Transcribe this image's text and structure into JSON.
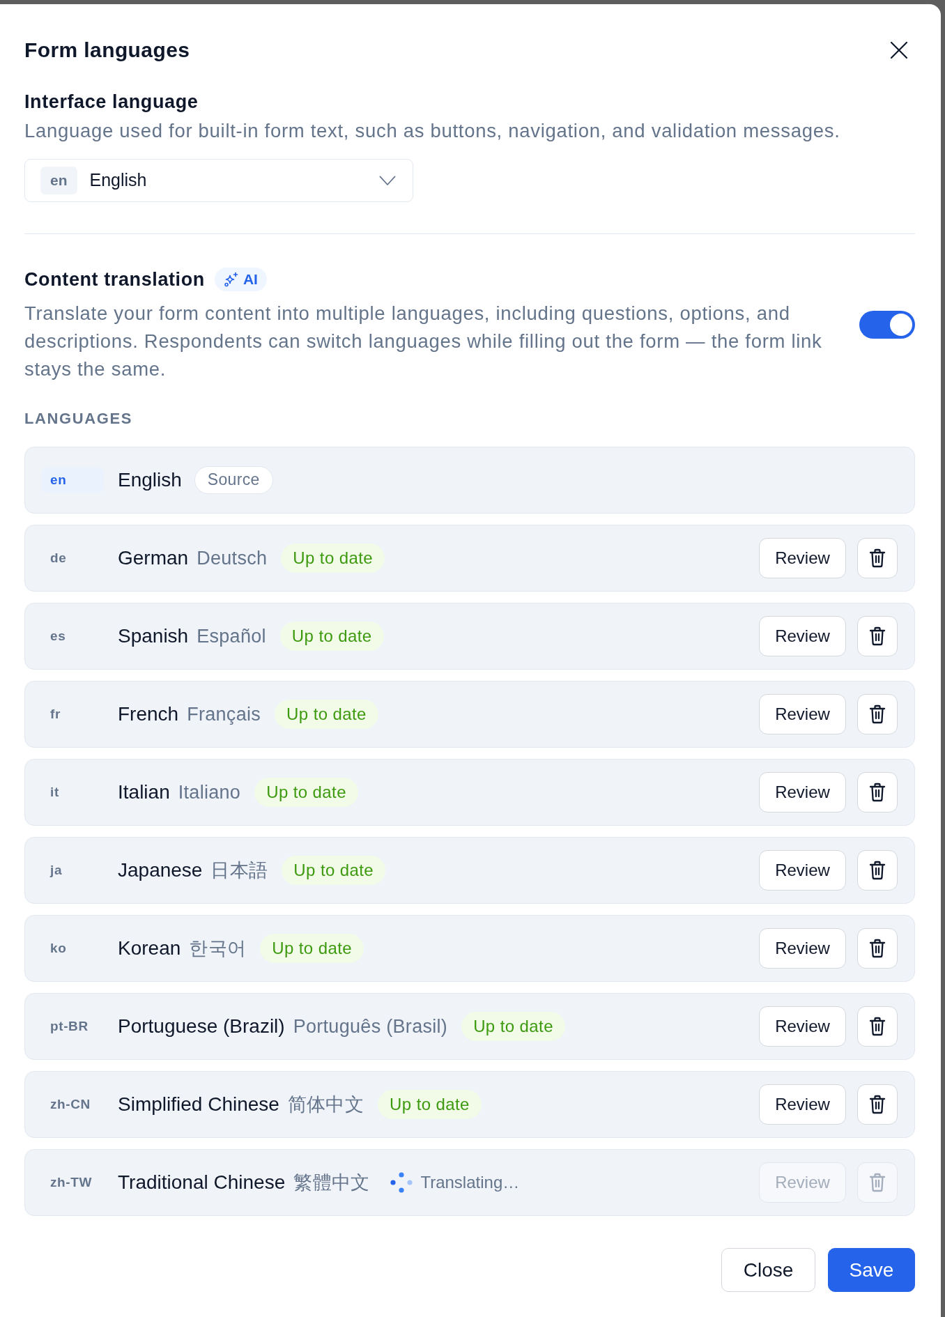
{
  "dialog": {
    "title": "Form languages"
  },
  "interface_language": {
    "title": "Interface language",
    "description": "Language used for built-in form text, such as buttons, navigation, and validation messages.",
    "select": {
      "code": "en",
      "value": "English"
    }
  },
  "content_translation": {
    "title": "Content translation",
    "badge": "AI",
    "description": "Translate your form content into multiple languages, including questions, options, and descriptions. Respondents can switch languages while filling out the form — the form link stays the same.",
    "on": true
  },
  "languages": {
    "heading": "LANGUAGES",
    "items": [
      {
        "code": "en",
        "name": "English",
        "status": {
          "kind": "source",
          "label": "Source"
        }
      },
      {
        "code": "de",
        "name": "German",
        "native": "Deutsch",
        "status": {
          "kind": "up_to_date",
          "label": "Up to date"
        },
        "actions": {
          "review": "Review",
          "disabled": false
        }
      },
      {
        "code": "es",
        "name": "Spanish",
        "native": "Español",
        "status": {
          "kind": "up_to_date",
          "label": "Up to date"
        },
        "actions": {
          "review": "Review",
          "disabled": false
        }
      },
      {
        "code": "fr",
        "name": "French",
        "native": "Français",
        "status": {
          "kind": "up_to_date",
          "label": "Up to date"
        },
        "actions": {
          "review": "Review",
          "disabled": false
        }
      },
      {
        "code": "it",
        "name": "Italian",
        "native": "Italiano",
        "status": {
          "kind": "up_to_date",
          "label": "Up to date"
        },
        "actions": {
          "review": "Review",
          "disabled": false
        }
      },
      {
        "code": "ja",
        "name": "Japanese",
        "native": "日本語",
        "status": {
          "kind": "up_to_date",
          "label": "Up to date"
        },
        "actions": {
          "review": "Review",
          "disabled": false
        }
      },
      {
        "code": "ko",
        "name": "Korean",
        "native": "한국어",
        "status": {
          "kind": "up_to_date",
          "label": "Up to date"
        },
        "actions": {
          "review": "Review",
          "disabled": false
        }
      },
      {
        "code": "pt-BR",
        "name": "Portuguese (Brazil)",
        "native": "Português (Brasil)",
        "status": {
          "kind": "up_to_date",
          "label": "Up to date"
        },
        "actions": {
          "review": "Review",
          "disabled": false
        }
      },
      {
        "code": "zh-CN",
        "name": "Simplified Chinese",
        "native": "简体中文",
        "status": {
          "kind": "up_to_date",
          "label": "Up to date"
        },
        "actions": {
          "review": "Review",
          "disabled": false
        }
      },
      {
        "code": "zh-TW",
        "name": "Traditional Chinese",
        "native": "繁體中文",
        "status": {
          "kind": "translating",
          "label": "Translating…"
        },
        "actions": {
          "review": "Review",
          "disabled": true
        }
      }
    ]
  },
  "footer": {
    "buttons": [
      {
        "label": "Close",
        "kind": "secondary"
      },
      {
        "label": "Save",
        "kind": "primary"
      }
    ]
  }
}
